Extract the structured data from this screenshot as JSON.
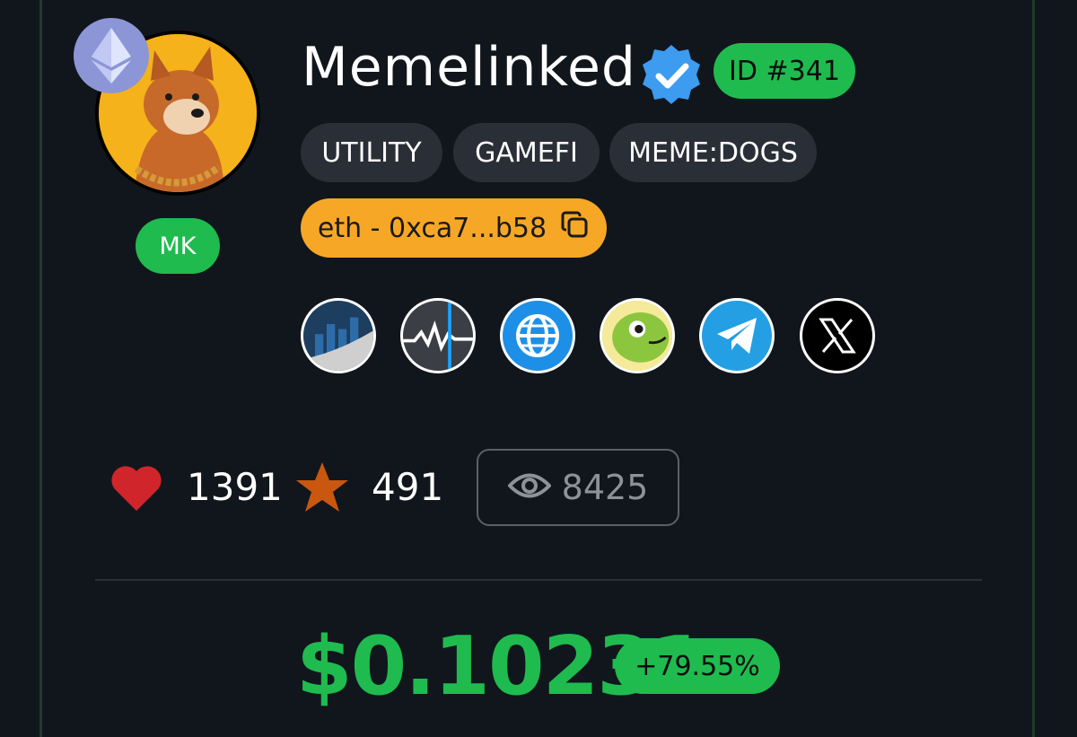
{
  "token": {
    "name": "Memelinked",
    "id_label": "ID #341",
    "symbol_badge": "MK",
    "chain_icon": "ethereum-icon",
    "avatar_icon": "shiba-dog-avatar"
  },
  "tags": [
    "UTILITY",
    "GAMEFI",
    "MEME:DOGS"
  ],
  "address": {
    "label": "eth - 0xca7...b58",
    "copy_icon": "copy-icon"
  },
  "socials": [
    {
      "name": "chart-icon"
    },
    {
      "name": "price-activity-icon"
    },
    {
      "name": "website-globe-icon"
    },
    {
      "name": "coingecko-icon"
    },
    {
      "name": "telegram-icon"
    },
    {
      "name": "x-twitter-icon"
    }
  ],
  "stats": {
    "likes": "1391",
    "stars": "491",
    "views": "8425"
  },
  "price": {
    "value": "$0.10231",
    "change": "+79.55%"
  },
  "colors": {
    "background": "#11161d",
    "accent_green": "#1fbb4f",
    "address_orange": "#f7a726",
    "tag_bg": "#2a2f37",
    "heart_red": "#d0262b",
    "star_orange": "#c9570f"
  }
}
